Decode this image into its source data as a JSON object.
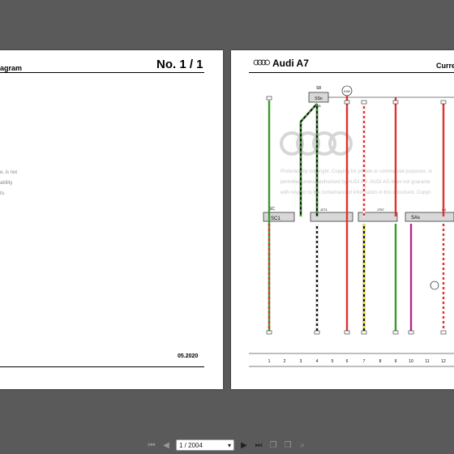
{
  "left_page": {
    "title": "agram",
    "page_no": "No.  1 / 1",
    "date": "05.2020",
    "notes": [
      "e, is not",
      "ability",
      "to."
    ]
  },
  "right_page": {
    "brand": "Audi A7",
    "header_right": "Curre",
    "watermark": [
      "Protected by copyright. Copying for private or commercial purposes, in",
      "permitted unless authorised by AUDI AG. AUDI AG does not guarante",
      "with respect to the correctness of information in this document. Copyri"
    ],
    "relays": [
      "S8",
      "SSo",
      "SA"
    ],
    "fuse_circle": "0:60",
    "connectors": [
      "SC",
      "SC1",
      "J271",
      "J757",
      "SAs",
      "C4"
    ],
    "column_numbers": [
      "1",
      "2",
      "3",
      "4",
      "5",
      "6",
      "7",
      "8",
      "9",
      "10",
      "11",
      "12"
    ],
    "wire_colors": {
      "green": "#3a9a2c",
      "red": "#e03030",
      "black": "#111111",
      "yellow": "#f2e200",
      "magenta": "#b02a8a"
    }
  },
  "toolbar": {
    "page_indicator": "1 / 2004",
    "dropdown_icon": "caret-down"
  }
}
